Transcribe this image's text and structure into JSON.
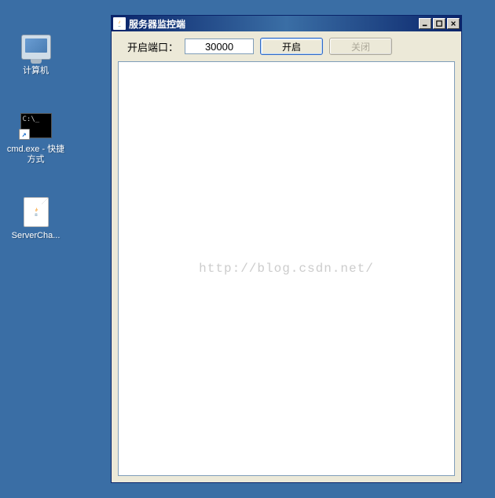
{
  "desktop": {
    "icons": [
      {
        "label": "计算机",
        "name": "computer-icon"
      },
      {
        "label": "cmd.exe - 快捷方式",
        "name": "cmd-shortcut-icon"
      },
      {
        "label": "ServerCha...",
        "name": "server-file-icon"
      }
    ]
  },
  "window": {
    "title": "服务器监控端",
    "toolbar": {
      "port_label": "开启端口：",
      "port_value": "30000",
      "open_label": "开启",
      "close_label": "关闭"
    },
    "watermark": "http://blog.csdn.net/"
  }
}
